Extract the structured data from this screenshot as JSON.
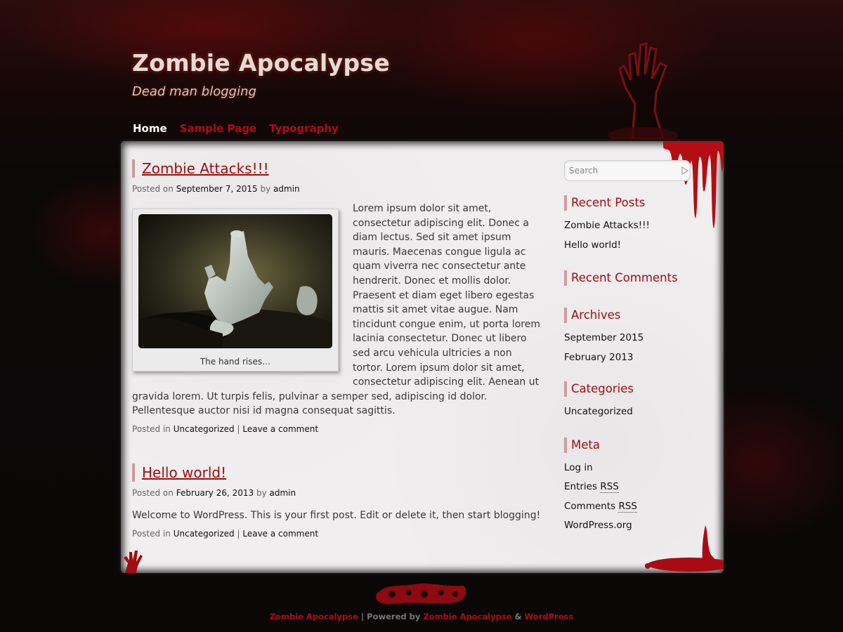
{
  "site": {
    "title": "Zombie Apocalypse",
    "description": "Dead man blogging"
  },
  "nav": {
    "items": [
      {
        "label": "Home",
        "current": true
      },
      {
        "label": "Sample Page",
        "current": false
      },
      {
        "label": "Typography",
        "current": false
      }
    ]
  },
  "posts": [
    {
      "title": "Zombie Attacks!!!",
      "posted_on_label": "Posted on",
      "date": "September 7, 2015",
      "by_label": "by",
      "author": "admin",
      "image_caption": "The hand rises…",
      "body": "Lorem ipsum dolor sit amet, consectetur adipiscing elit. Donec a diam lectus. Sed sit amet ipsum mauris. Maecenas congue ligula ac quam viverra nec consectetur ante hendrerit. Donec et mollis dolor. Praesent et diam eget libero egestas mattis sit amet vitae augue. Nam tincidunt congue enim, ut porta lorem lacinia consectetur. Donec ut libero sed arcu vehicula ultricies a non tortor. Lorem ipsum dolor sit amet, consectetur adipiscing elit. Aenean ut gravida lorem. Ut turpis felis, pulvinar a semper sed, adipiscing id dolor. Pellentesque auctor nisi id magna consequat sagittis.",
      "posted_in_label": "Posted in",
      "category": "Uncategorized",
      "separator": "|",
      "comment_link": "Leave a comment"
    },
    {
      "title": "Hello world!",
      "posted_on_label": "Posted on",
      "date": "February 26, 2013",
      "by_label": "by",
      "author": "admin",
      "body": "Welcome to WordPress. This is your first post. Edit or delete it, then start blogging!",
      "posted_in_label": "Posted in",
      "category": "Uncategorized",
      "separator": "|",
      "comment_link": "Leave a comment"
    }
  ],
  "sidebar": {
    "search_placeholder": "Search",
    "recent_posts": {
      "title": "Recent Posts",
      "items": [
        "Zombie Attacks!!!",
        "Hello world!"
      ]
    },
    "recent_comments": {
      "title": "Recent Comments"
    },
    "archives": {
      "title": "Archives",
      "items": [
        "September 2015",
        "February 2013"
      ]
    },
    "categories": {
      "title": "Categories",
      "items": [
        "Uncategorized"
      ]
    },
    "meta": {
      "title": "Meta",
      "log_in": "Log in",
      "entries_prefix": "Entries ",
      "comments_prefix": "Comments ",
      "rss": "RSS",
      "wordpress_org": "WordPress.org"
    }
  },
  "footer": {
    "site_link": "Zombie Apocalypse",
    "separator": "|",
    "powered_by": "Powered by",
    "theme_link": "Zombie Apocalypse",
    "amp": "&",
    "wp_link": "WordPress"
  },
  "colors": {
    "accent_red": "#b40c12",
    "title_red": "#9c0d12",
    "panel_bg": "#f0eeee"
  }
}
